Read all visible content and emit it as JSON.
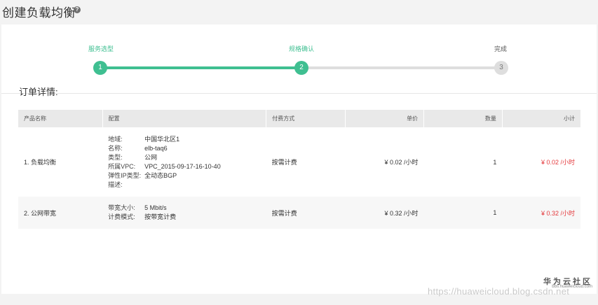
{
  "page": {
    "title": "创建负载均衡",
    "help_icon": "question-circle"
  },
  "steps": [
    {
      "label": "服务选型",
      "number": "1",
      "state": "done"
    },
    {
      "label": "规格确认",
      "number": "2",
      "state": "current"
    },
    {
      "label": "完成",
      "number": "3",
      "state": "todo"
    }
  ],
  "order": {
    "title": "订单详情:",
    "headers": {
      "name": "产品名称",
      "config": "配置",
      "payment": "付费方式",
      "price": "单价",
      "quantity": "数量",
      "subtotal": "小计"
    },
    "rows": [
      {
        "name": "1. 负载均衡",
        "config": [
          {
            "k": "地域:",
            "v": "中国华北区1"
          },
          {
            "k": "名称:",
            "v": "elb-taq6"
          },
          {
            "k": "类型:",
            "v": "公网"
          },
          {
            "k": "所属VPC:",
            "v": "VPC_2015-09-17-16-10-40"
          },
          {
            "k": "弹性IP类型:",
            "v": "全动态BGP"
          },
          {
            "k": "描述:",
            "v": ""
          }
        ],
        "payment": "按需计费",
        "price": "¥ 0.02 /小时",
        "quantity": "1",
        "subtotal": "¥ 0.02 /小时"
      },
      {
        "name": "2. 公网带宽",
        "config": [
          {
            "k": "带宽大小:",
            "v": "5 Mbit/s"
          },
          {
            "k": "计费模式:",
            "v": "按带宽计费"
          }
        ],
        "payment": "按需计费",
        "price": "¥ 0.32 /小时",
        "quantity": "1",
        "subtotal": "¥ 0.32 /小时"
      }
    ]
  },
  "watermark": {
    "brand": "华为云社区",
    "sub": "bbs.huaweicloud.com",
    "url": "https://huaweicloud.blog.csdn.net"
  },
  "colors": {
    "accent": "#3fbf91",
    "price_red": "#e4393c",
    "inactive": "#dedede"
  }
}
